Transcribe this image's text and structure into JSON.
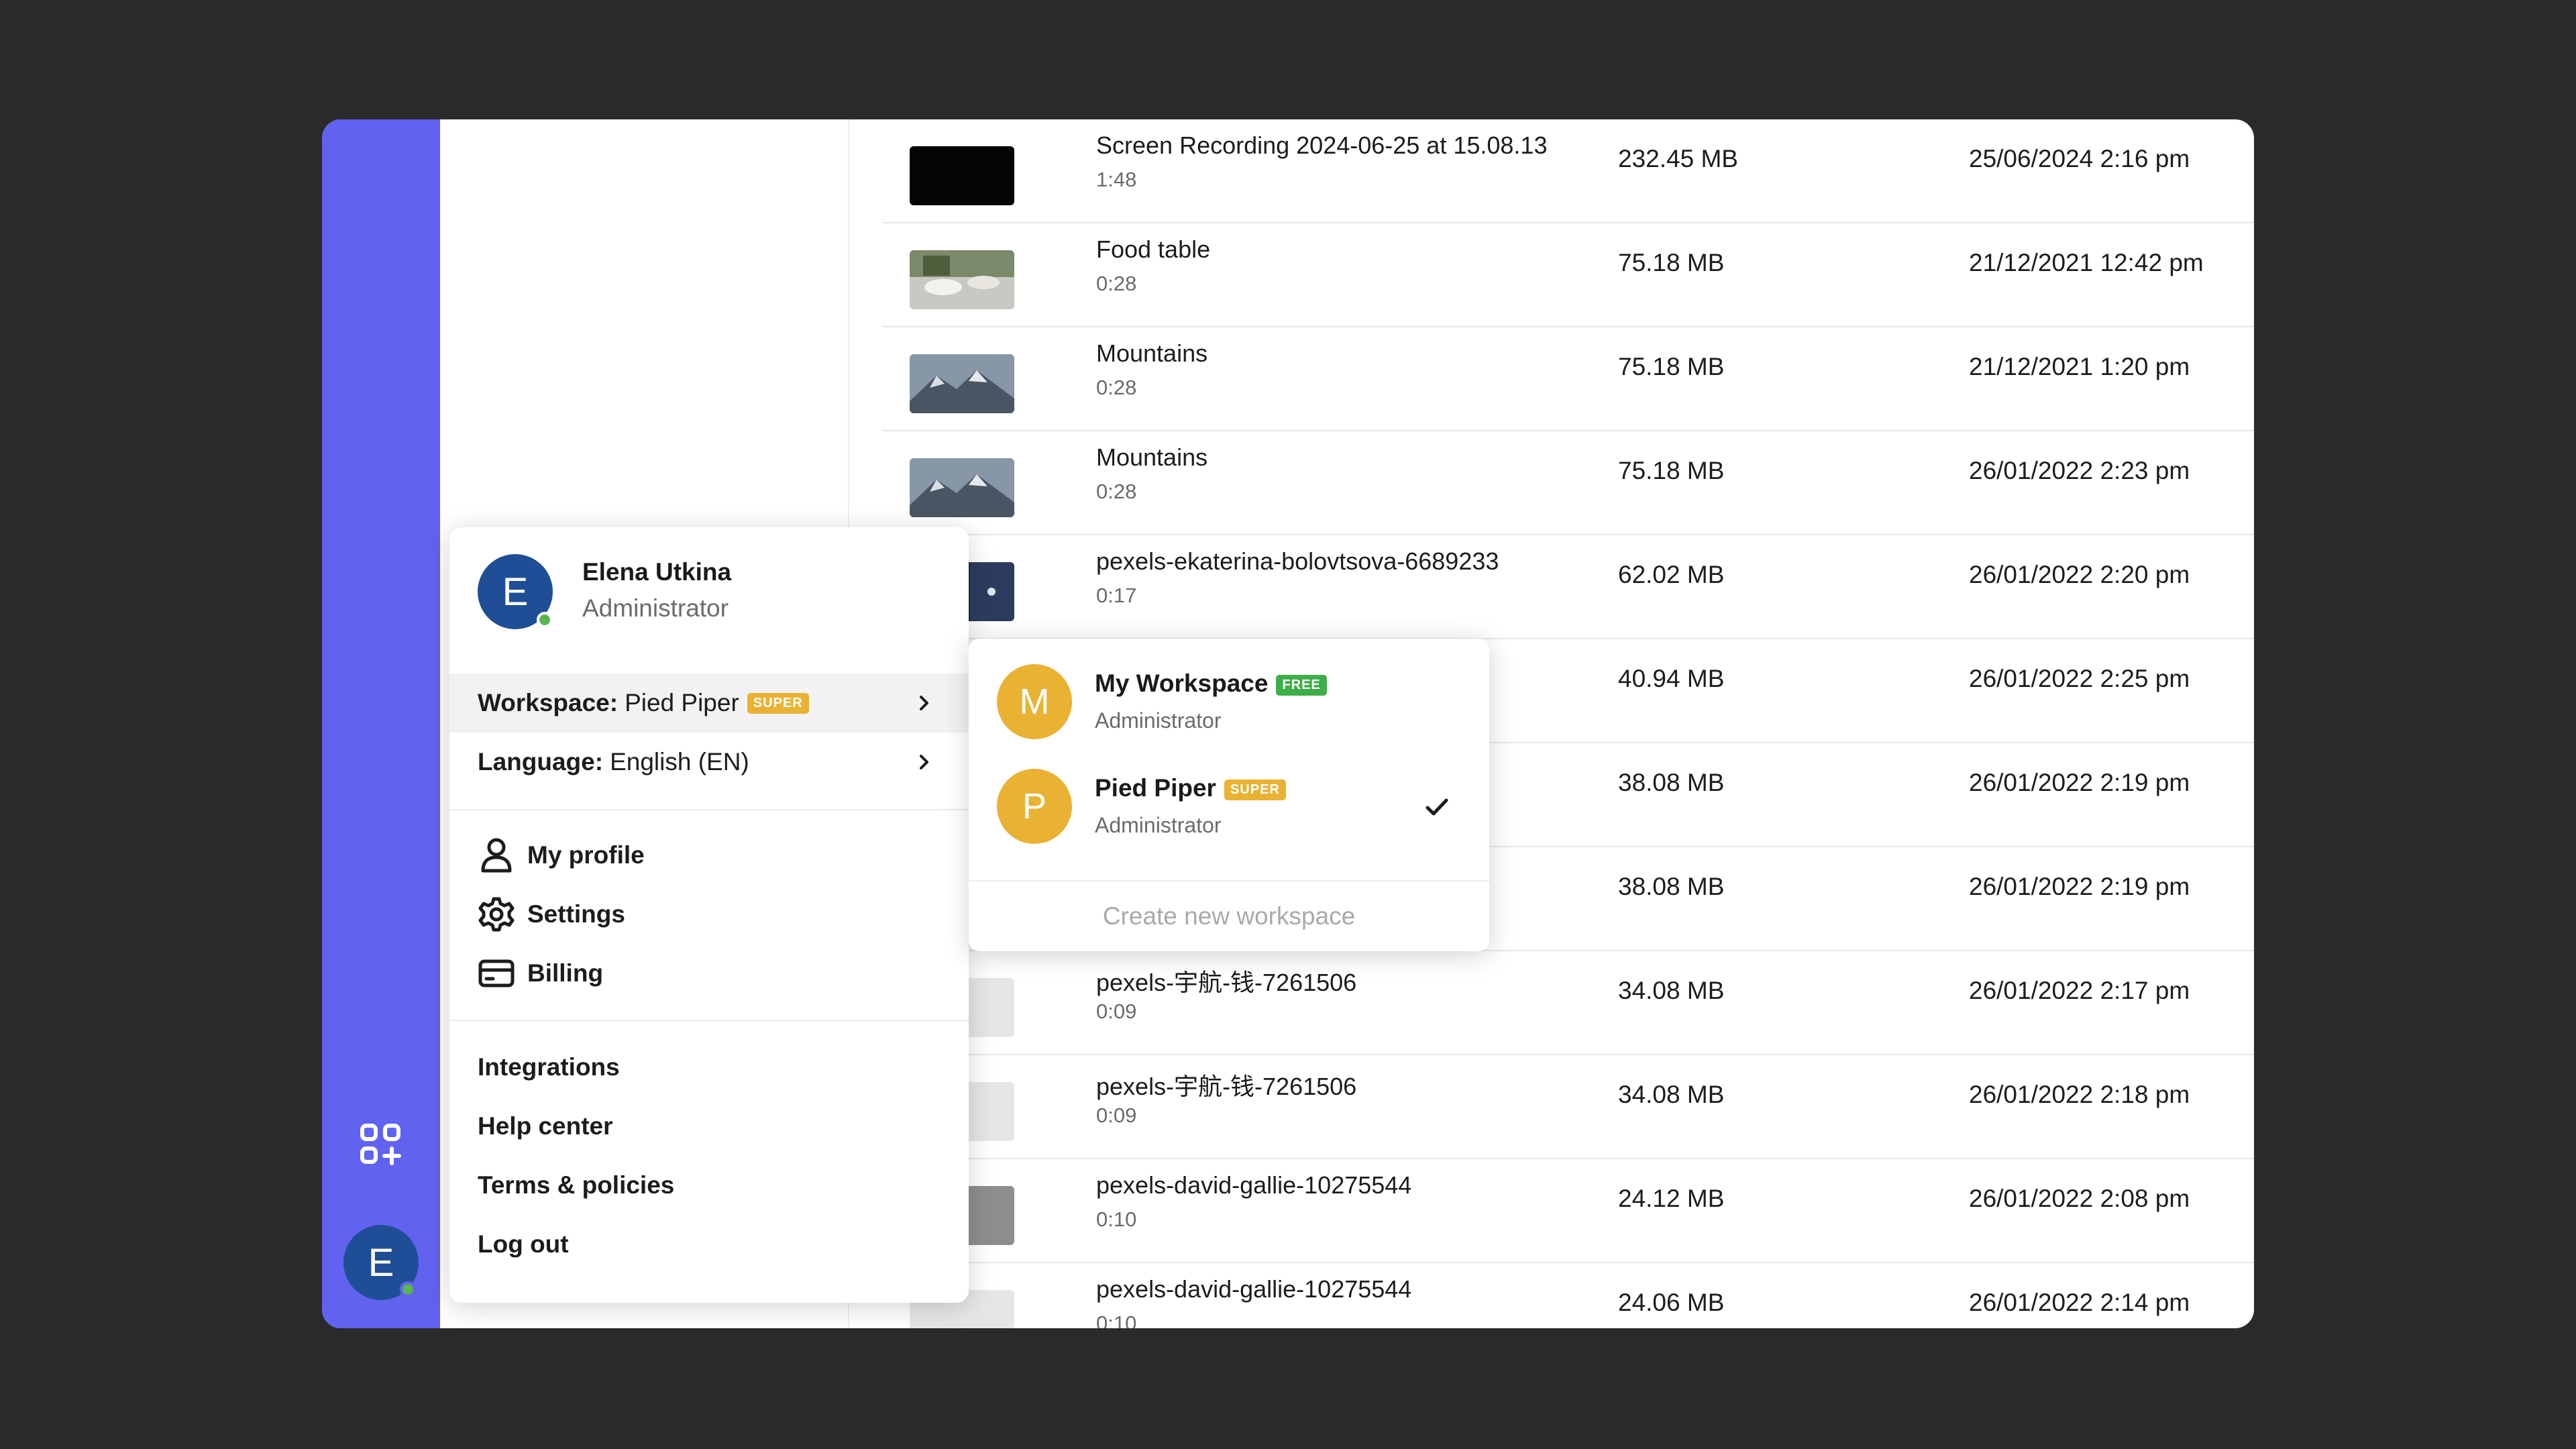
{
  "user": {
    "initial": "E",
    "name": "Elena Utkina",
    "role": "Administrator"
  },
  "menu": {
    "workspace_label": "Workspace:",
    "workspace_value": "Pied Piper",
    "workspace_badge": "SUPER",
    "language_label": "Language:",
    "language_value": "English (EN)",
    "my_profile": "My profile",
    "settings": "Settings",
    "billing": "Billing",
    "integrations": "Integrations",
    "help_center": "Help center",
    "terms": "Terms & policies",
    "logout": "Log out"
  },
  "workspaces": [
    {
      "initial": "M",
      "name": "My Workspace",
      "badge": "FREE",
      "role": "Administrator",
      "selected": false
    },
    {
      "initial": "P",
      "name": "Pied Piper",
      "badge": "SUPER",
      "role": "Administrator",
      "selected": true
    }
  ],
  "create_workspace": "Create new workspace",
  "files": [
    {
      "name": "Screen Recording 2024-06-25 at 15.08.13",
      "duration": "1:48",
      "size": "232.45 MB",
      "date": "25/06/2024 2:16 pm",
      "thumb": "black"
    },
    {
      "name": "Food table",
      "duration": "0:28",
      "size": "75.18 MB",
      "date": "21/12/2021 12:42 pm",
      "thumb": "food"
    },
    {
      "name": "Mountains",
      "duration": "0:28",
      "size": "75.18 MB",
      "date": "21/12/2021 1:20 pm",
      "thumb": "mountain"
    },
    {
      "name": "Mountains",
      "duration": "0:28",
      "size": "75.18 MB",
      "date": "26/01/2022 2:23 pm",
      "thumb": "mountain"
    },
    {
      "name": "pexels-ekaterina-bolovtsova-6689233",
      "duration": "0:17",
      "size": "62.02 MB",
      "date": "26/01/2022 2:20 pm",
      "thumb": "dark"
    },
    {
      "name": "",
      "duration": "",
      "size": "40.94 MB",
      "date": "26/01/2022 2:25 pm",
      "thumb": "none"
    },
    {
      "name": "",
      "duration": "",
      "size": "38.08 MB",
      "date": "26/01/2022 2:19 pm",
      "thumb": "none"
    },
    {
      "name": "",
      "duration": "",
      "size": "38.08 MB",
      "date": "26/01/2022 2:19 pm",
      "thumb": "none"
    },
    {
      "name": "pexels-宇航-钱-7261506",
      "duration": "0:09",
      "size": "34.08 MB",
      "date": "26/01/2022 2:17 pm",
      "thumb": "light"
    },
    {
      "name": "pexels-宇航-钱-7261506",
      "duration": "0:09",
      "size": "34.08 MB",
      "date": "26/01/2022 2:18 pm",
      "thumb": "light"
    },
    {
      "name": "pexels-david-gallie-10275544",
      "duration": "0:10",
      "size": "24.12 MB",
      "date": "26/01/2022 2:08 pm",
      "thumb": "grey"
    },
    {
      "name": "pexels-david-gallie-10275544",
      "duration": "0:10",
      "size": "24.06 MB",
      "date": "26/01/2022 2:14 pm",
      "thumb": "light"
    }
  ],
  "colors": {
    "rail": "#6162f0",
    "avatar_user": "#1f4e96",
    "avatar_workspace": "#e9b233",
    "badge_super": "#e9b233",
    "badge_free": "#3fae49",
    "online": "#59b44f",
    "annotation_arrow": "#6162f0"
  },
  "icons": {
    "rail_top": "apps-add-icon",
    "rail_middle": "chat-icon",
    "profile": "user-icon",
    "settings": "gear-icon",
    "billing": "credit-card-icon"
  }
}
